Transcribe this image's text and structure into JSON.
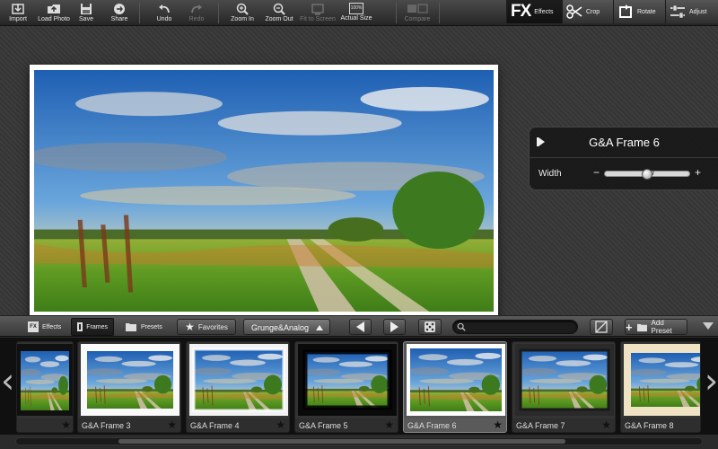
{
  "toolbar": {
    "import": "Import",
    "load_photo": "Load Photo",
    "save": "Save",
    "share": "Share",
    "undo": "Undo",
    "redo": "Redo",
    "zoom_in": "Zoom In",
    "zoom_out": "Zoom Out",
    "fit_to_screen": "Fit to Screen",
    "actual_size": "Actual Size",
    "actual_size_badge": "100%",
    "compare": "Compare",
    "fx_logo": "FX",
    "effects": "Effects",
    "crop": "Crop",
    "rotate": "Rotate",
    "adjust": "Adjust"
  },
  "hud": {
    "title": "G&A Frame 6",
    "width_label": "Width",
    "minus": "−",
    "plus": "+",
    "width_value": "100",
    "width_fraction": 0.5
  },
  "bottombar": {
    "effects_tab": "Effects",
    "frames_tab": "Frames",
    "presets_tab": "Presets",
    "favorites": "Favorites",
    "category": "Grunge&Analog",
    "search_placeholder": "",
    "add_preset": "Add Preset"
  },
  "thumbnails": [
    {
      "label": ""
    },
    {
      "label": "G&A Frame 3"
    },
    {
      "label": "G&A Frame 4"
    },
    {
      "label": "G&A Frame 5"
    },
    {
      "label": "G&A Frame 6"
    },
    {
      "label": "G&A Frame 7"
    },
    {
      "label": "G&A Frame 8"
    }
  ],
  "colors": {
    "star": "#111111",
    "selected_thumb": "#555555"
  }
}
